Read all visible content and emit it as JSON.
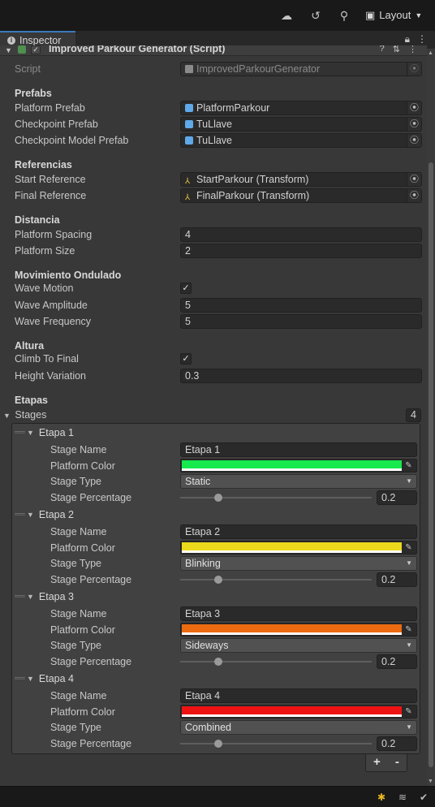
{
  "toolbar": {
    "layout_label": "Layout",
    "icons": [
      "cloud-icon",
      "history-icon",
      "search-icon",
      "layout-icon"
    ]
  },
  "tab": {
    "label": "Inspector"
  },
  "component": {
    "title": "Improved Parkour Generator (Script)"
  },
  "script": {
    "label": "Script",
    "value": "ImprovedParkourGenerator"
  },
  "prefabs": {
    "header": "Prefabs",
    "platform_label": "Platform Prefab",
    "platform_value": "PlatformParkour",
    "checkpoint_label": "Checkpoint Prefab",
    "checkpoint_value": "TuLlave",
    "checkpoint_model_label": "Checkpoint Model Prefab",
    "checkpoint_model_value": "TuLlave"
  },
  "referencias": {
    "header": "Referencias",
    "start_label": "Start Reference",
    "start_value": "StartParkour (Transform)",
    "final_label": "Final Reference",
    "final_value": "FinalParkour (Transform)"
  },
  "distancia": {
    "header": "Distancia",
    "spacing_label": "Platform Spacing",
    "spacing_value": "4",
    "size_label": "Platform Size",
    "size_value": "2"
  },
  "movimiento": {
    "header": "Movimiento Ondulado",
    "wave_motion_label": "Wave Motion",
    "wave_motion_checked": true,
    "amplitude_label": "Wave Amplitude",
    "amplitude_value": "5",
    "frequency_label": "Wave Frequency",
    "frequency_value": "5"
  },
  "altura": {
    "header": "Altura",
    "climb_label": "Climb To Final",
    "climb_checked": true,
    "height_label": "Height Variation",
    "height_value": "0.3"
  },
  "etapas": {
    "header": "Etapas",
    "stages_label": "Stages",
    "count": "4",
    "field_labels": {
      "name": "Stage Name",
      "color": "Platform Color",
      "type": "Stage Type",
      "percentage": "Stage Percentage"
    },
    "items": [
      {
        "title": "Etapa 1",
        "name": "Etapa 1",
        "color": "#16e94d",
        "type": "Static",
        "percentage": "0.2"
      },
      {
        "title": "Etapa 2",
        "name": "Etapa 2",
        "color": "#ecd91c",
        "type": "Blinking",
        "percentage": "0.2"
      },
      {
        "title": "Etapa 3",
        "name": "Etapa 3",
        "color": "#ec6b10",
        "type": "Sideways",
        "percentage": "0.2"
      },
      {
        "title": "Etapa 4",
        "name": "Etapa 4",
        "color": "#ee1313",
        "type": "Combined",
        "percentage": "0.2"
      }
    ],
    "add_label": "+",
    "remove_label": "-"
  }
}
